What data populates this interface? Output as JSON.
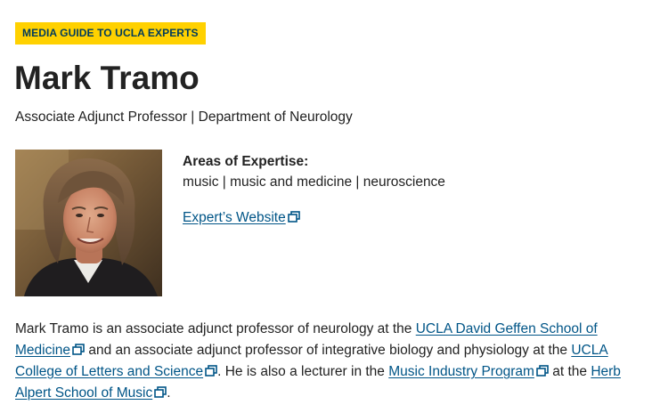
{
  "badge": "MEDIA GUIDE TO UCLA EXPERTS",
  "name": "Mark Tramo",
  "title": "Associate Adjunct Professor | Department of Neurology",
  "photo_alt": "Mark Tramo",
  "expertise": {
    "label": "Areas of Expertise:",
    "value": "music | music and medicine | neuroscience"
  },
  "website_link": "Expert’s Website",
  "bio": {
    "t1": "Mark Tramo is an associate adjunct professor of neurology at the ",
    "link1": "UCLA David Geffen School of Medicine",
    "t2": " and an associate adjunct professor of integrative biology and physiology at the ",
    "link2": "UCLA College of Letters and Science",
    "t3": ". He is also a lecturer in the ",
    "link3": "Music Industry Program",
    "t4": " at the ",
    "link4": "Herb Alpert School of Music",
    "t5": "."
  },
  "colors": {
    "badge_bg": "#FFD100",
    "badge_text": "#003B5C",
    "link": "#005587",
    "text": "#222222"
  },
  "icons": {
    "external_link": "external-link-icon"
  }
}
